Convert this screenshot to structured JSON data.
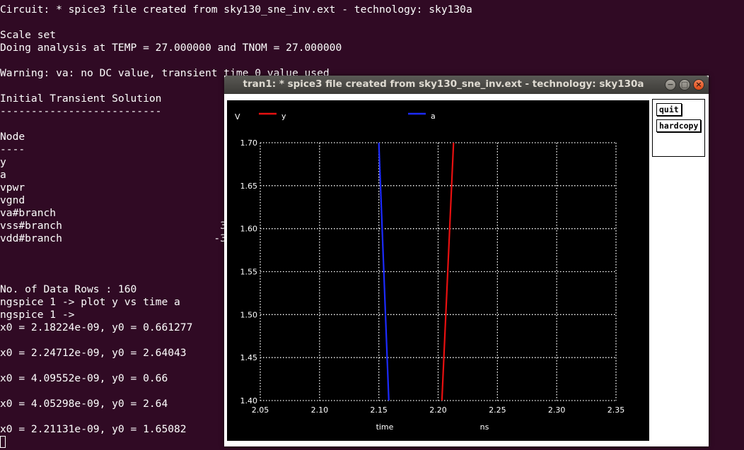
{
  "terminal": {
    "lines": [
      "Circuit: * spice3 file created from sky130_sne_inv.ext - technology: sky130a",
      "",
      "Scale set",
      "Doing analysis at TEMP = 27.000000 and TNOM = 27.000000",
      "",
      "Warning: va: no DC value, transient time 0 value used",
      "",
      "Initial Transient Solution",
      "--------------------------",
      "",
      "Node",
      "----",
      "y",
      "a",
      "vpwr",
      "vgnd",
      "va#branch",
      "vss#branch",
      "vdd#branch",
      "",
      "",
      "",
      "No. of Data Rows : 160",
      "ngspice 1 -> plot y vs time a",
      "ngspice 1 ->",
      "x0 = 2.18224e-09, y0 = 0.661277",
      "",
      "x0 = 2.24712e-09, y0 = 2.64043",
      "",
      "x0 = 4.09552e-09, y0 = 0.66",
      "",
      "x0 = 4.05298e-09, y0 = 2.64",
      "",
      "x0 = 2.21131e-09, y0 = 1.65082"
    ],
    "partial_values": [
      {
        "line": 17,
        "text": "3"
      },
      {
        "line": 18,
        "text": "-3"
      }
    ]
  },
  "plot_window": {
    "title": "tran1: * spice3 file created from sky130_sne_inv.ext - technology: sky130a",
    "buttons": {
      "quit": "quit",
      "hardcopy": "hardcopy"
    },
    "window_controls": {
      "minimize": "−",
      "maximize": "□",
      "close": "×"
    }
  },
  "chart_data": {
    "type": "line",
    "ylabel": "V",
    "xlabel": "time",
    "xunit": "ns",
    "xlim": [
      2.05,
      2.35
    ],
    "ylim": [
      1.4,
      1.7
    ],
    "xticks": [
      "2.05",
      "2.10",
      "2.15",
      "2.20",
      "2.25",
      "2.30",
      "2.35"
    ],
    "yticks": [
      "1.40",
      "1.45",
      "1.50",
      "1.55",
      "1.60",
      "1.65",
      "1.70"
    ],
    "grid": true,
    "legend_position": "top",
    "background": "#000000",
    "series": [
      {
        "name": "y",
        "color": "#e81010",
        "x": [
          2.2032,
          2.213
        ],
        "y": [
          1.4,
          1.7
        ]
      },
      {
        "name": "a",
        "color": "#1c2bff",
        "x": [
          2.15,
          2.1584
        ],
        "y": [
          1.7,
          1.4
        ]
      }
    ]
  }
}
